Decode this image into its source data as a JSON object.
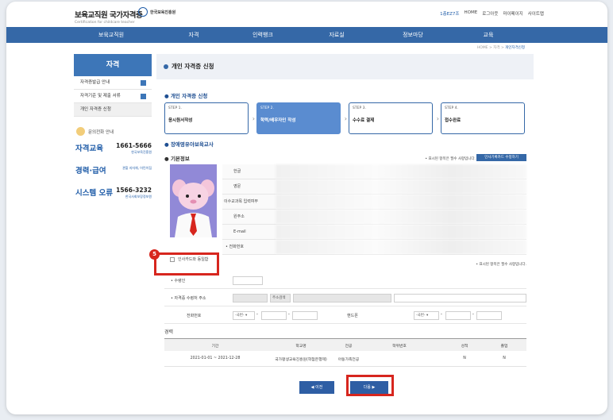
{
  "header": {
    "logo_title": "보육교직원 국가자격증",
    "logo_sub": "Certification for childcare teacher",
    "org": "한국보육진흥원",
    "links": [
      "1층EZ7조",
      "HOME",
      "로그아웃",
      "마이페이지",
      "사이트맵"
    ]
  },
  "gnb": [
    "보육교직원",
    "자격",
    "인력뱅크",
    "자료실",
    "정보마당",
    "교육"
  ],
  "breadcrumb": {
    "home": "HOME",
    "sep": ">",
    "mid": "자격",
    "current": "개인자격신청"
  },
  "sidebar": {
    "title": "자격",
    "items": [
      {
        "label": "자격증발급 안내",
        "has_plus": true
      },
      {
        "label": "자격기준 및 제출 서류",
        "has_plus": true
      },
      {
        "label": "개인 자격증 신청",
        "has_plus": false
      }
    ],
    "inquiry": "문의전화 안내",
    "contacts": [
      {
        "label": "자격교육",
        "number": "1661-5666",
        "sub": "한국보육진흥원"
      },
      {
        "label": "경력·급여",
        "number": "",
        "sub": "관할 지자체, 어린이집"
      },
      {
        "label": "시스템 오류",
        "number": "1566-3232",
        "sub": "한국사회보장정보원"
      }
    ]
  },
  "page_title": "개인 자격증 신청",
  "section_apply": "개인 자격증 신청",
  "steps": [
    {
      "num": "STEP 1.",
      "title": "응시원서작성",
      "active": false
    },
    {
      "num": "STEP 2.",
      "title": "학력/배우자인 작성",
      "active": true
    },
    {
      "num": "STEP 3.",
      "title": "수수료 결제",
      "active": false
    },
    {
      "num": "STEP 4.",
      "title": "접수완료",
      "active": false
    }
  ],
  "section_cert": "장애영유아보육교사",
  "basic_info": "기본정보",
  "required_note": "• 표시된 항목은 필수 사항입니다.",
  "edit_button": "인사기록카드 수정하기",
  "profile_fields": [
    "한글",
    "영문",
    "이수교과목 입력여부",
    "원주소",
    "E-mail",
    "• 전화번호"
  ],
  "same_as_card": "인사카드와 동일함",
  "required_note2": "• 표시된 항목은 필수 사항입니다.",
  "annotation_num": "5",
  "form": {
    "recipient_label": "• 수령인",
    "address_label": "• 자격증 수령처 주소",
    "address_search": "주소검색",
    "phone_label": "전화번호",
    "mobile_label": "핸드폰",
    "select_placeholder": "-국번- ▾",
    "dash": "-"
  },
  "career": {
    "title": "경력",
    "headers": [
      "기간",
      "학교명",
      "전공",
      "학위번호",
      "성적",
      "졸업"
    ],
    "rows": [
      [
        "2021-01-01 ~ 2021-12-28",
        "국가평생교육진흥원(학점은행제)",
        "아동가족전공",
        "",
        "N",
        "N"
      ]
    ]
  },
  "buttons": {
    "prev": "◀ 이전",
    "next": "다음 ▶"
  },
  "colors": {
    "primary": "#3568a7",
    "highlight": "#d7261e",
    "active_step": "#5a8cd0"
  }
}
